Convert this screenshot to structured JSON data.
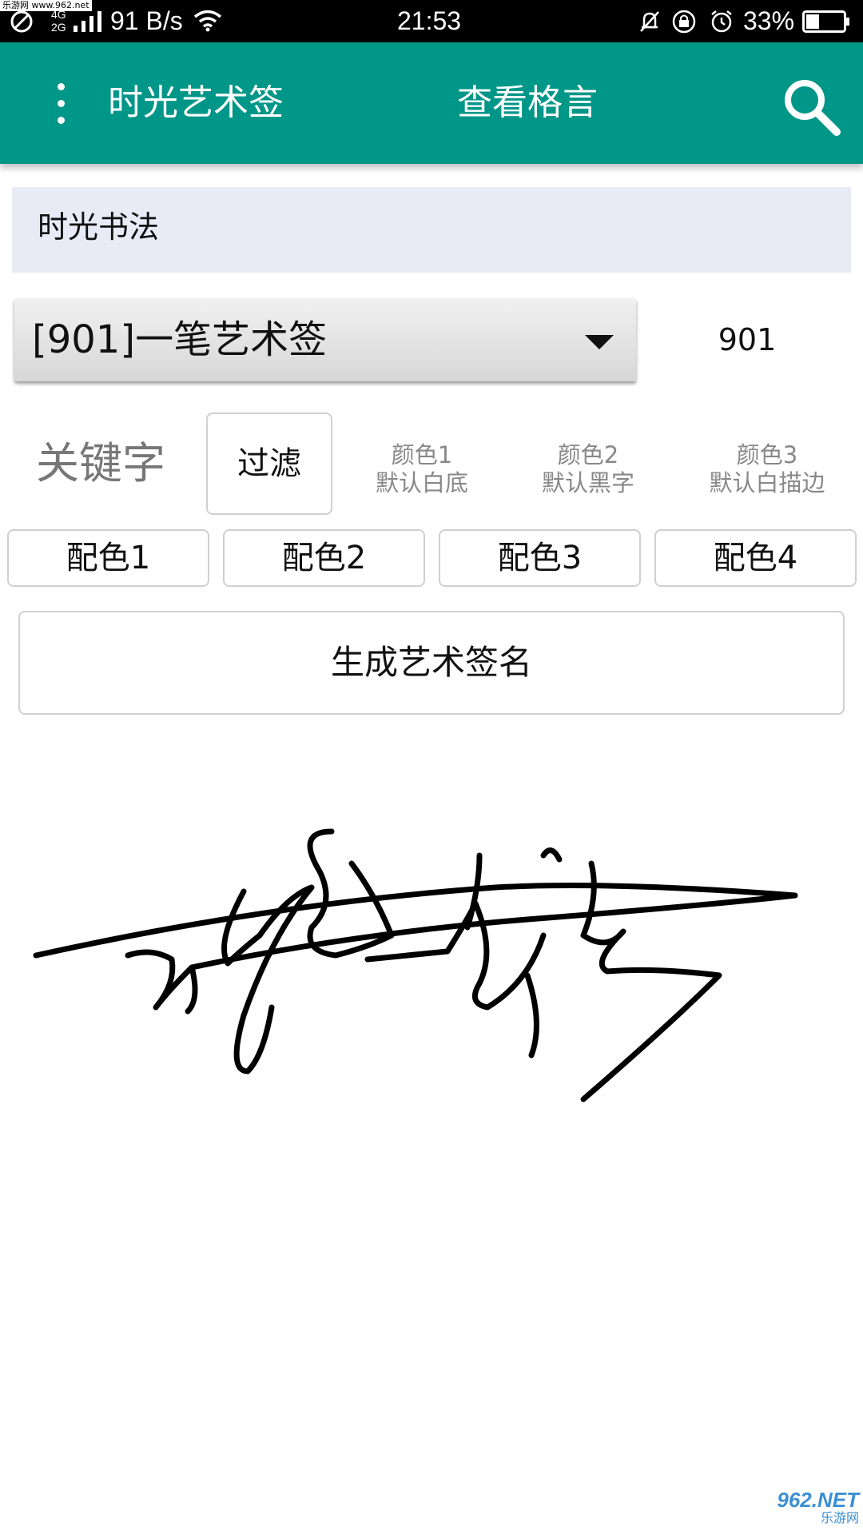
{
  "status_bar": {
    "watermark": "乐游网 www.962.net",
    "network_type": "4G 2G",
    "speed": "91 B/s",
    "time": "21:53",
    "battery": "33%",
    "icons": [
      "dnd-icon",
      "signal-icon",
      "wifi-icon",
      "mute-icon",
      "lock-rotation-icon",
      "alarm-icon",
      "battery-icon"
    ]
  },
  "app_bar": {
    "title": "时光艺术签",
    "aphorism_link": "查看格言",
    "icons": [
      "overflow-menu-icon",
      "search-icon"
    ]
  },
  "section": {
    "header": "时光书法"
  },
  "style_spinner": {
    "selected": "[901]一笔艺术签",
    "code": "901"
  },
  "keyword_row": {
    "keyword_label": "关键字",
    "filter_button": "过滤",
    "color1": {
      "line1": "颜色1",
      "line2": "默认白底"
    },
    "color2": {
      "line1": "颜色2",
      "line2": "默认黑字"
    },
    "color3": {
      "line1": "颜色3",
      "line2": "默认白描边"
    }
  },
  "schemes": [
    "配色1",
    "配色2",
    "配色3",
    "配色4"
  ],
  "generate_button": "生成艺术签名",
  "corner_logo": {
    "main": "962.NET",
    "sub": "乐游网"
  },
  "colors": {
    "app_bar": "#009688",
    "section_bg": "#e8eaf6",
    "status_bar": "#000000"
  }
}
